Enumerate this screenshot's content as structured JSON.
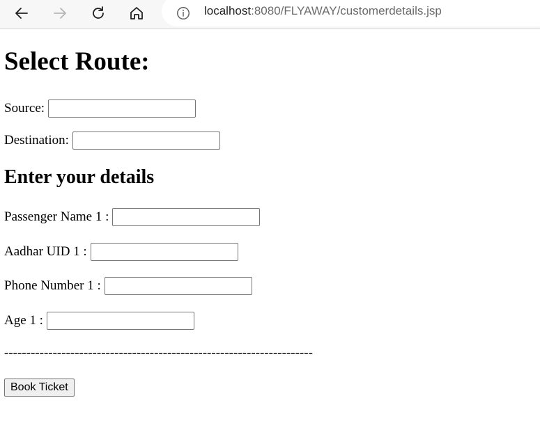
{
  "browser": {
    "url_host": "localhost",
    "url_rest": ":8080/FLYAWAY/customerdetails.jsp"
  },
  "route": {
    "heading": "Select Route:",
    "source_label": "Source:",
    "source_value": "",
    "destination_label": "Destination:",
    "destination_value": ""
  },
  "details": {
    "heading": "Enter your details",
    "passenger_name_label": "Passenger Name 1 :",
    "passenger_name_value": "",
    "aadhar_label": "Aadhar UID 1 :",
    "aadhar_value": "",
    "phone_label": "Phone Number 1 :",
    "phone_value": "",
    "age_label": "Age 1 :",
    "age_value": ""
  },
  "separator": "----------------------------------------------------------------------",
  "book_button": "Book Ticket",
  "icons": [
    "back-arrow-icon",
    "forward-arrow-icon",
    "refresh-icon",
    "home-icon",
    "info-icon"
  ]
}
